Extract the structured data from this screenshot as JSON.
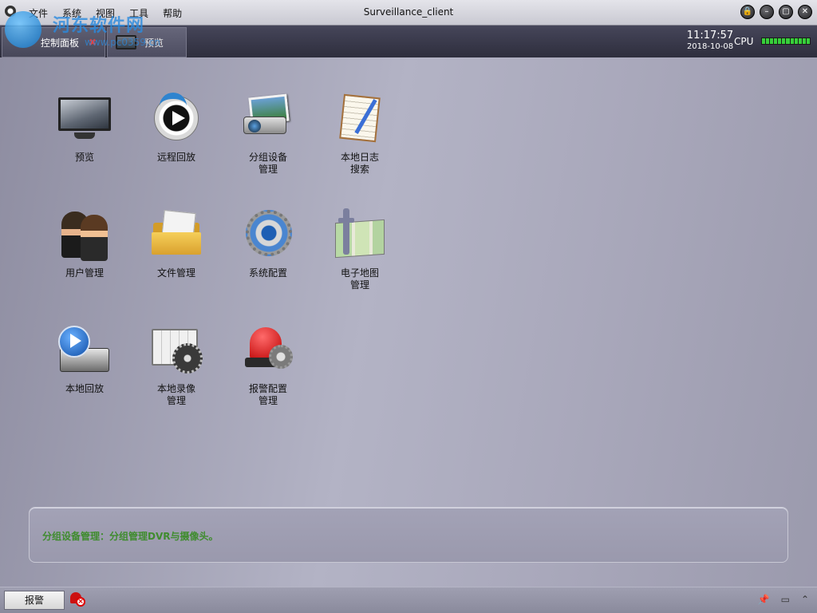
{
  "window": {
    "title": "Surveillance_client",
    "menu": [
      "文件",
      "系统",
      "视图",
      "工具",
      "帮助"
    ],
    "buttons": {
      "lock": "🔒",
      "minimize": "–",
      "maximize": "▢",
      "close": "✕"
    }
  },
  "watermark": {
    "text": "河东软件网",
    "url": "www.pc0359.cn"
  },
  "tabs": [
    {
      "label": "控制面板",
      "close": "✖"
    },
    {
      "label": "预览"
    }
  ],
  "status": {
    "time": "11:17:57",
    "date": "2018-10-08",
    "cpu_label": "CPU"
  },
  "tiles": [
    {
      "label": "预览",
      "icon": "monitor-icon"
    },
    {
      "label": "远程回放",
      "icon": "remote-playback-icon"
    },
    {
      "label": "分组设备\n管理",
      "icon": "camera-icon"
    },
    {
      "label": "本地日志\n搜索",
      "icon": "log-search-icon"
    },
    {
      "label": "用户管理",
      "icon": "users-icon"
    },
    {
      "label": "文件管理",
      "icon": "folder-icon"
    },
    {
      "label": "系统配置",
      "icon": "gear-icon"
    },
    {
      "label": "电子地图\n管理",
      "icon": "map-icon"
    },
    {
      "label": "本地回放",
      "icon": "local-playback-icon"
    },
    {
      "label": "本地录像\n管理",
      "icon": "recording-icon"
    },
    {
      "label": "报警配置\n管理",
      "icon": "alarm-icon"
    }
  ],
  "info": {
    "text": "分组设备管理：分组管理DVR与摄像头。"
  },
  "statusbar": {
    "alarm_label": "报警",
    "icons": [
      "📌",
      "▭",
      "⌃"
    ]
  }
}
